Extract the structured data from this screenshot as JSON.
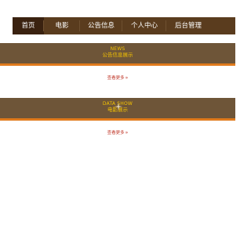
{
  "nav": {
    "items": [
      {
        "label": "首页",
        "active": true
      },
      {
        "label": "电影",
        "active": false
      },
      {
        "label": "公告信息",
        "active": false
      },
      {
        "label": "个人中心",
        "active": false
      },
      {
        "label": "后台管理",
        "active": false
      }
    ]
  },
  "sections": {
    "news": {
      "title_en": "NEWS",
      "title_cn": "公告信息展示",
      "more_label": "查看更多",
      "more_icon": "double-chevron-right-icon"
    },
    "data": {
      "title_en": "DATA SHOW",
      "title_cn": "电影展示",
      "more_label": "查看更多",
      "more_icon": "double-chevron-right-icon"
    }
  },
  "colors": {
    "nav_bg": "#5a3c1e",
    "nav_active": "#3a2210",
    "banner_bg": "#6e5538",
    "banner_accent": "#e07a1c",
    "title_yellow": "#f5c400",
    "link_red": "#c0392b"
  }
}
